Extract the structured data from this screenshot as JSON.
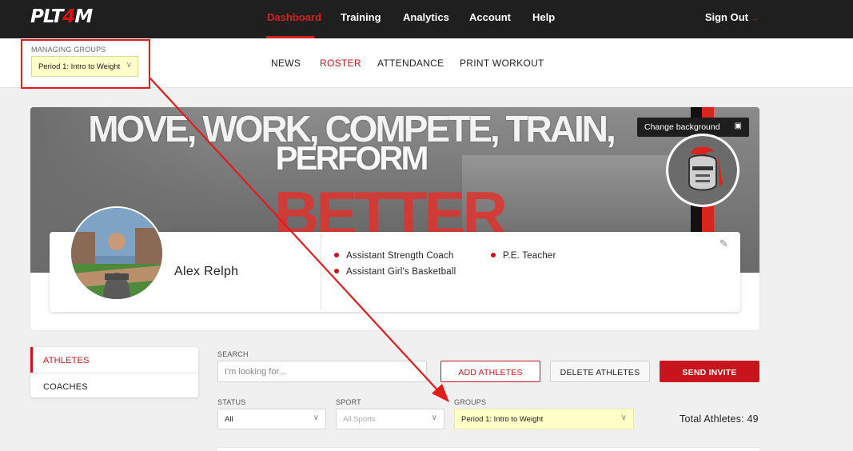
{
  "app": {
    "logo_prefix": "PLT",
    "logo_four": "4",
    "logo_suffix": "M"
  },
  "topnav": {
    "items": [
      "Dashboard",
      "Training",
      "Analytics",
      "Account",
      "Help"
    ],
    "active": "Dashboard",
    "sign_out": "Sign Out"
  },
  "managing_groups": {
    "label": "MANAGING GROUPS",
    "selected": "Period 1: Intro to Weight"
  },
  "subnav": {
    "items": [
      "NEWS",
      "ROSTER",
      "ATTENDANCE",
      "PRINT WORKOUT"
    ],
    "active": "ROSTER"
  },
  "banner": {
    "motto_line1": "MOVE, WORK, COMPETE, TRAIN,",
    "motto_line2": "PERFORM",
    "motto_line3": "BETTER",
    "change_background": "Change background"
  },
  "profile": {
    "name": "Alex Relph",
    "roles": [
      "Assistant Strength Coach",
      "Assistant Girl's Basketball",
      "P.E. Teacher"
    ]
  },
  "side_tabs": [
    "ATHLETES",
    "COACHES"
  ],
  "filters": {
    "search_label": "SEARCH",
    "search_placeholder": "I'm looking for...",
    "status_label": "STATUS",
    "status_value": "All",
    "sport_label": "SPORT",
    "sport_value": "All Sports",
    "groups_label": "GROUPS",
    "groups_value": "Period 1: Intro to Weight"
  },
  "buttons": {
    "add": "ADD ATHLETES",
    "delete": "DELETE ATHLETES",
    "send": "SEND INVITE"
  },
  "totals": {
    "label": "Total Athletes: 49"
  },
  "colors": {
    "brand_red": "#c8141c",
    "nav_bg": "#1f1f1f",
    "highlight_yellow": "#ffffc8",
    "annotation_red": "#e21b1b"
  }
}
